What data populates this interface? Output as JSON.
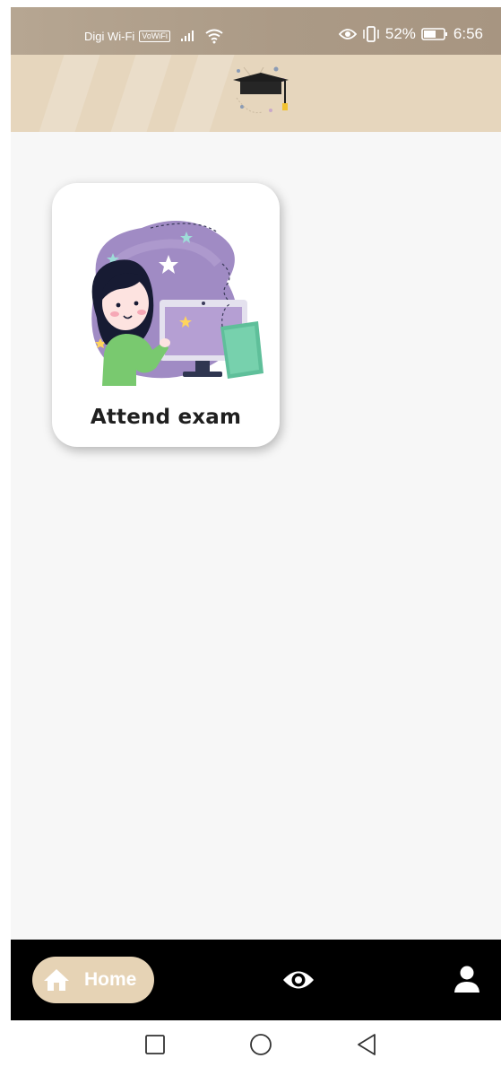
{
  "status_bar": {
    "carrier": "Digi Wi-Fi",
    "vowifi_badge": "VoWiFi",
    "battery_percent": "52%",
    "time": "6:56",
    "icons": [
      "signal-icon",
      "wifi-icon",
      "eye-comfort-icon",
      "vibrate-icon",
      "battery-icon"
    ]
  },
  "header": {
    "logo_icon": "graduation-cap-icon",
    "background_color": "#e6d6bd"
  },
  "main": {
    "cards": [
      {
        "label": "Attend exam",
        "illustration": "girl-at-computer-illustration"
      }
    ]
  },
  "bottom_nav": {
    "items": [
      {
        "label": "Home",
        "icon": "home-icon",
        "active": true
      },
      {
        "label": "",
        "icon": "eye-icon",
        "active": false
      },
      {
        "label": "",
        "icon": "profile-icon",
        "active": false
      }
    ],
    "active_color": "#e6d3b5"
  },
  "system_nav": {
    "buttons": [
      "recent-apps-icon",
      "home-circle-icon",
      "back-icon"
    ]
  }
}
